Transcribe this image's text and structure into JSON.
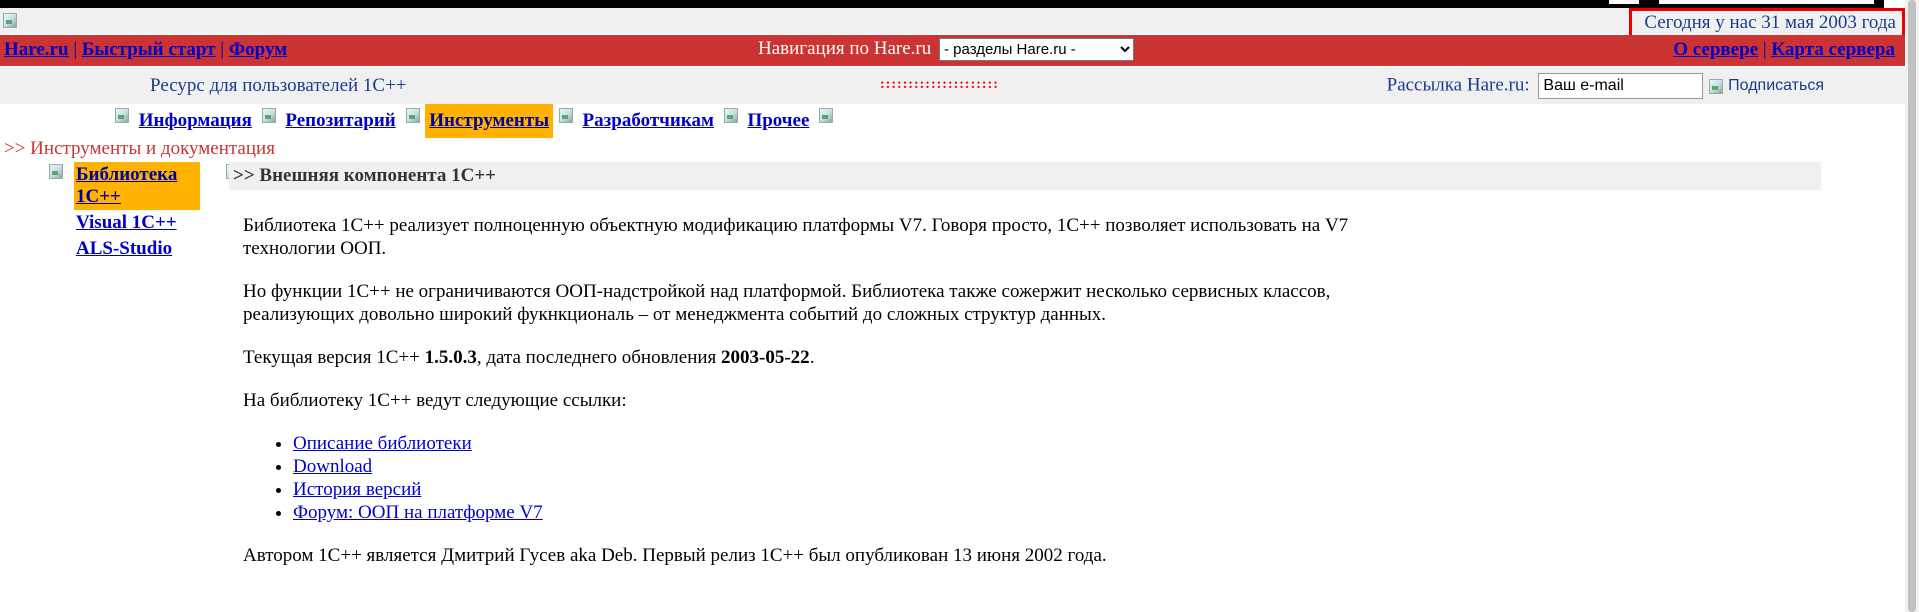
{
  "header": {
    "date_text": "Сегодня у нас 31 мая 2003 года"
  },
  "nav": {
    "links_left": [
      "Hare.ru",
      "Быстрый старт",
      "Форум"
    ],
    "separator": "|",
    "center_label": "Навигация по Hare.ru",
    "select_value": "- разделы Hare.ru -",
    "links_right": [
      "О сервере",
      "Карта сервера"
    ]
  },
  "info_row": {
    "resource_title": "Ресурс для пользователей 1С++",
    "dots": ":::::::::::::::::::::",
    "newsletter_label": "Рассылка Hare.ru:",
    "email_value": "Ваш e-mail",
    "subscribe_label": "Подписаться"
  },
  "menu": {
    "items": [
      "Информация",
      "Репозитарий",
      "Инструменты",
      "Разработчикам",
      "Прочее"
    ],
    "active": "Инструменты"
  },
  "breadcrumb": ">> Инструменты и документация",
  "sidebar": {
    "items": [
      "Библиотека 1С++",
      "Visual 1C++",
      "ALS-Studio"
    ],
    "active": "Библиотека 1С++"
  },
  "content": {
    "title": ">> Внешняя компонента 1С++",
    "p1": "Библиотека 1С++ реализует полноценную объектную модификацию платформы V7. Говоря просто, 1С++ позволяет использовать на V7 технологии ООП.",
    "p2": "Но функции 1С++ не ограничиваются ООП-надстройкой над платформой. Библиотека также сожержит несколько сервисных классов, реализующих довольно широкий фукнкциональ – от менеджмента событий до сложных структур данных.",
    "p3_prefix": "Текущая версия 1С++ ",
    "version": "1.5.0.3",
    "p3_middle": ", дата последнего обновления ",
    "date": "2003-05-22",
    "p3_suffix": ".",
    "p4": "На библиотеку 1С++ ведут следующие ссылки:",
    "links": [
      "Описание библиотеки",
      "Download",
      "История версий",
      "Форум: ООП на платформе V7"
    ],
    "p5": "Автором 1С++ является Дмитрий Гусев aka Deb. Первый релиз 1С++ был опубликован 13 июня 2002 года."
  }
}
